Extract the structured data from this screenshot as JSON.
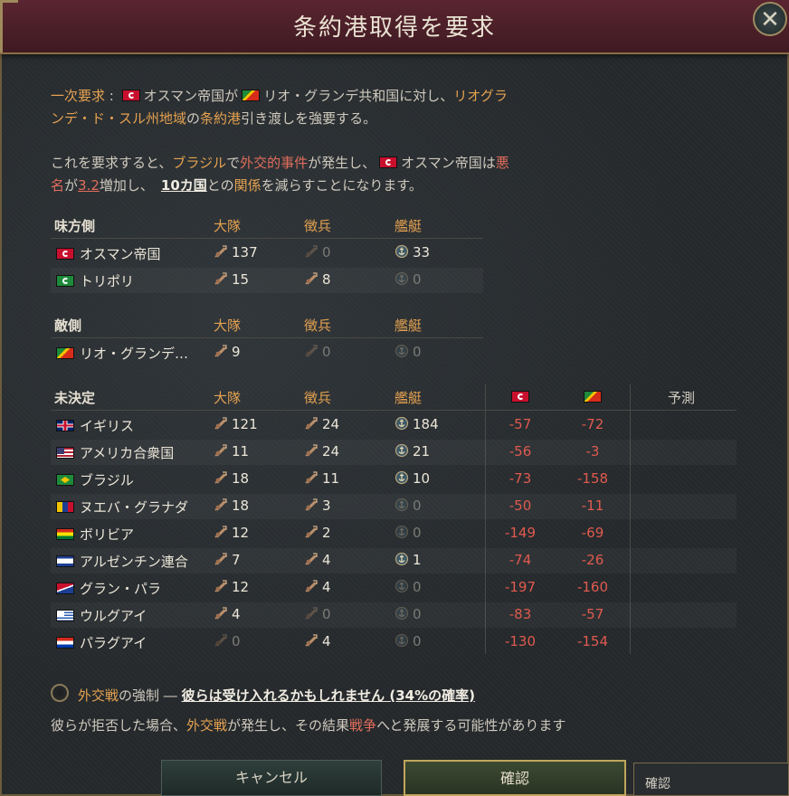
{
  "dialog": {
    "title": "条約港取得を要求",
    "close_label": "✕"
  },
  "description": {
    "line1": {
      "p1": "一次要求",
      "p2": " : ",
      "p3": "オスマン帝国",
      "p4": "が",
      "p5": "リオ・グランデ共和国",
      "p6": "に対し、",
      "p7": "リオグラ"
    },
    "line2": {
      "p1": "ンデ・ド・スル",
      "p2": "州地域",
      "p3": "の",
      "p4": "条約港",
      "p5": "引き渡しを強要する。"
    },
    "line3": {
      "p1": "これを要求すると、",
      "p2": "ブラジル",
      "p3": "で",
      "p4": "外交的事件",
      "p5": "が発生し、",
      "p6": "オスマン帝国",
      "p7": "は",
      "p8": "悪"
    },
    "line4": {
      "p1": "名",
      "p2": "が",
      "p3": "3.2",
      "p4": "増加し、",
      "p5": "10カ国",
      "p6": "との",
      "p7": "関係",
      "p8": "を減らすことになります。"
    }
  },
  "columns": {
    "battalions": "大隊",
    "conscripts": "徴兵",
    "ships": "艦艇",
    "forecast": "予測"
  },
  "allies": {
    "header": "味方側",
    "rows": [
      {
        "flag": "ottoman",
        "name": "オスマン帝国",
        "battalions": "137",
        "conscripts": "0",
        "ships": "33"
      },
      {
        "flag": "tripoli",
        "name": "トリポリ",
        "battalions": "15",
        "conscripts": "8",
        "ships": "0"
      }
    ]
  },
  "enemies": {
    "header": "敵側",
    "rows": [
      {
        "flag": "rio",
        "name": "リオ・グランデ…",
        "battalions": "9",
        "conscripts": "0",
        "ships": "0"
      }
    ]
  },
  "undecided": {
    "header": "未決定",
    "rows": [
      {
        "flag": "uk",
        "name": "イギリス",
        "battalions": "121",
        "conscripts": "24",
        "ships": "184",
        "op_ottoman": "-57",
        "op_rio": "-72"
      },
      {
        "flag": "usa",
        "name": "アメリカ合衆国",
        "battalions": "11",
        "conscripts": "24",
        "ships": "21",
        "op_ottoman": "-56",
        "op_rio": "-3"
      },
      {
        "flag": "bra",
        "name": "ブラジル",
        "battalions": "18",
        "conscripts": "11",
        "ships": "10",
        "op_ottoman": "-73",
        "op_rio": "-158"
      },
      {
        "flag": "ng",
        "name": "ヌエバ・グラナダ",
        "battalions": "18",
        "conscripts": "3",
        "ships": "0",
        "op_ottoman": "-50",
        "op_rio": "-11"
      },
      {
        "flag": "bol",
        "name": "ボリビア",
        "battalions": "12",
        "conscripts": "2",
        "ships": "0",
        "op_ottoman": "-149",
        "op_rio": "-69"
      },
      {
        "flag": "arg",
        "name": "アルゼンチン連合",
        "battalions": "7",
        "conscripts": "4",
        "ships": "1",
        "op_ottoman": "-74",
        "op_rio": "-26"
      },
      {
        "flag": "gp",
        "name": "グラン・パラ",
        "battalions": "12",
        "conscripts": "4",
        "ships": "0",
        "op_ottoman": "-197",
        "op_rio": "-160"
      },
      {
        "flag": "uru",
        "name": "ウルグアイ",
        "battalions": "4",
        "conscripts": "0",
        "ships": "0",
        "op_ottoman": "-83",
        "op_rio": "-57"
      },
      {
        "flag": "par",
        "name": "パラグアイ",
        "battalions": "0",
        "conscripts": "4",
        "ships": "0",
        "op_ottoman": "-130",
        "op_rio": "-154"
      }
    ]
  },
  "enforce": {
    "p1": "外交戦",
    "p2": "の強制 ― ",
    "p3": "彼らは受け入れるかもしれません (34%の確率)"
  },
  "warning": {
    "p1": "彼らが拒否した場合、",
    "p2": "外交戦",
    "p3": "が発生し、その結果",
    "p4": "戦争",
    "p5": "へと発展する可能性があります"
  },
  "buttons": {
    "cancel": "キャンセル",
    "confirm": "確認"
  },
  "tooltip": "確認",
  "colors": {
    "accent_orange": "#e5a250",
    "negative_red": "#e05a4e",
    "title_bar": "#4a1f28"
  }
}
